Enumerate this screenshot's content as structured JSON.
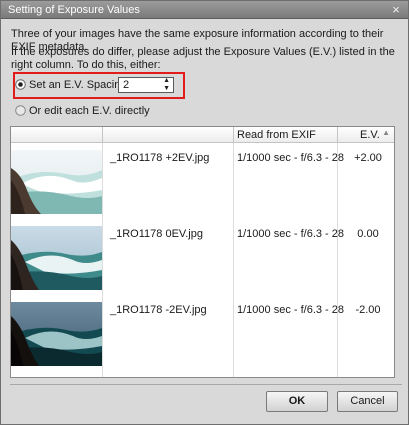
{
  "dialog": {
    "title": "Setting of Exposure Values",
    "close_glyph": "×",
    "intro_line1": "Three of your images have the same exposure information according to their EXIF metadata.",
    "intro_line2": "If the exposures do differ, please adjust the Exposure Values (E.V.) listed in the right column. To do this, either:"
  },
  "options": {
    "spacing_label": "Set an E.V. Spacing:",
    "spacing_value": "2",
    "edit_label": "Or edit each E.V. directly",
    "selected": "spacing"
  },
  "table": {
    "columns": [
      "",
      "",
      "Read from EXIF",
      "E.V."
    ],
    "rows": [
      {
        "file": "_1RO1178  +2EV.jpg",
        "exif": "1/1000 sec - f/6.3 - 28",
        "ev": "+2.00",
        "thumb": "ocean-wave-bright"
      },
      {
        "file": "_1RO1178  0EV.jpg",
        "exif": "1/1000 sec - f/6.3 - 28",
        "ev": "0.00",
        "thumb": "ocean-wave-normal"
      },
      {
        "file": "_1RO1178  -2EV.jpg",
        "exif": "1/1000 sec - f/6.3 - 28",
        "ev": "-2.00",
        "thumb": "ocean-wave-dark"
      }
    ]
  },
  "buttons": {
    "ok": "OK",
    "cancel": "Cancel"
  },
  "colors": {
    "highlight_box": "#e21b1b",
    "titlebar": "#8a8a8a",
    "dialog_bg": "#d9d9d9"
  }
}
